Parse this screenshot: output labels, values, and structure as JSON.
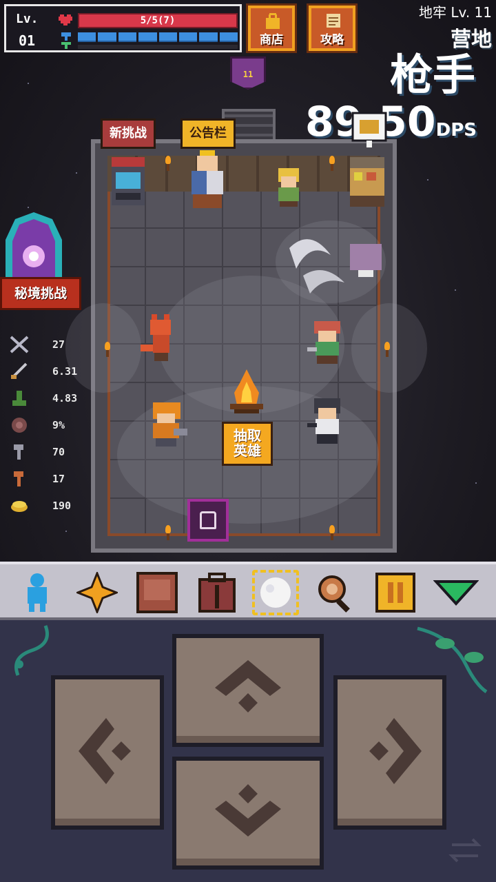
{
  "hud": {
    "level_label": "Lv.",
    "level_number": "01",
    "hp_text": "5/5(7)",
    "mp_segments": 8
  },
  "top_buttons": {
    "shop_label": "商店",
    "guide_label": "攻略"
  },
  "location": {
    "dungeon_level": "地牢 Lv. 11",
    "area_name": "营地",
    "class_name": "枪手"
  },
  "dps": {
    "value": "89.50",
    "unit": "DPS"
  },
  "banner": {
    "level": "11"
  },
  "room_signs": {
    "new_challenge": "新挑战",
    "bulletin_board": "公告栏"
  },
  "recruit_button": {
    "label": "抽取\n英雄"
  },
  "portal": {
    "label": "秘境挑战"
  },
  "stats": [
    {
      "icon": "crossed-swords-icon",
      "value": "27"
    },
    {
      "icon": "sword-icon",
      "value": "6.31"
    },
    {
      "icon": "boot-icon",
      "value": "4.83"
    },
    {
      "icon": "shield-icon",
      "value": "9%"
    },
    {
      "icon": "gray-key-icon",
      "value": "70"
    },
    {
      "icon": "bronze-key-icon",
      "value": "17"
    },
    {
      "icon": "gold-coin-icon",
      "value": "190"
    }
  ],
  "tabs": [
    {
      "name": "hero-icon"
    },
    {
      "name": "sparkle-icon"
    },
    {
      "name": "book-icon"
    },
    {
      "name": "backpack-icon"
    },
    {
      "name": "egg-icon"
    },
    {
      "name": "magnifier-icon"
    },
    {
      "name": "pause-icon"
    },
    {
      "name": "collapse-arrow-icon"
    }
  ],
  "colors": {
    "hp": "#d8384a",
    "mp": "#3d8fe0",
    "accent_gold": "#f0b428",
    "portal_red": "#b8301e",
    "panel": "#32334a"
  }
}
